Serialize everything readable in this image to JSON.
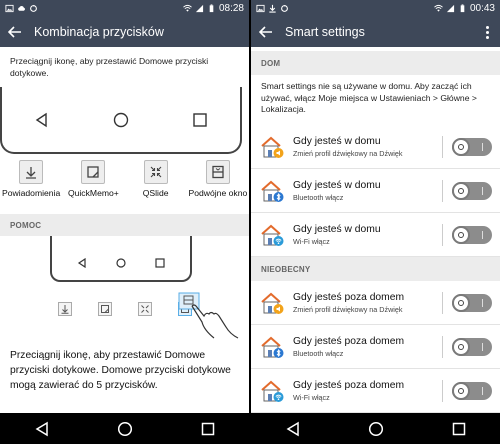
{
  "left": {
    "status": {
      "time": "08:28"
    },
    "appbar": {
      "title": "Kombinacja przycisków"
    },
    "instruction": "Przeciągnij ikonę, aby przestawić Domowe przyciski dotykowe.",
    "buttons": [
      {
        "label": "Powiadomienia",
        "icon": "notification-pull-down-icon"
      },
      {
        "label": "QuickMemo+",
        "icon": "quickmemo-icon"
      },
      {
        "label": "QSlide",
        "icon": "qslide-icon"
      },
      {
        "label": "Podwójne okno",
        "icon": "dual-window-icon"
      }
    ],
    "help_section": {
      "header": "POMOC",
      "text": "Przeciągnij ikonę, aby przestawić Domowe przyciski dotykowe. Domowe przyciski dotykowe mogą zawierać do 5 przycisków."
    }
  },
  "right": {
    "status": {
      "time": "00:43"
    },
    "appbar": {
      "title": "Smart settings"
    },
    "section_home": {
      "header": "DOM",
      "description": "Smart settings nie są używane w domu. Aby zacząć ich używać, włącz Moje miejsca w Ustawieniach > Główne > Lokalizacja.",
      "rows": [
        {
          "title": "Gdy jesteś w domu",
          "subtitle": "Zmień profil dźwiękowy na Dźwięk",
          "icon": "home-sound-icon",
          "on": false
        },
        {
          "title": "Gdy jesteś w domu",
          "subtitle": "Bluetooth włącz",
          "icon": "home-bluetooth-icon",
          "on": false
        },
        {
          "title": "Gdy jesteś w domu",
          "subtitle": "Wi-Fi włącz",
          "icon": "home-wifi-icon",
          "on": false
        }
      ]
    },
    "section_away": {
      "header": "NIEOBECNY",
      "rows": [
        {
          "title": "Gdy jesteś poza domem",
          "subtitle": "Zmień profil dźwiękowy na Dźwięk",
          "icon": "away-sound-icon",
          "on": false
        },
        {
          "title": "Gdy jesteś poza domem",
          "subtitle": "Bluetooth włącz",
          "icon": "away-bluetooth-icon",
          "on": false
        },
        {
          "title": "Gdy jesteś poza domem",
          "subtitle": "Wi-Fi włącz",
          "icon": "away-wifi-icon",
          "on": false
        }
      ]
    }
  },
  "colors": {
    "appbar": "#3e4859",
    "toggle_off": "#8c8c8c",
    "section_bg": "#ececec",
    "house_orange": "#e36b2c"
  }
}
